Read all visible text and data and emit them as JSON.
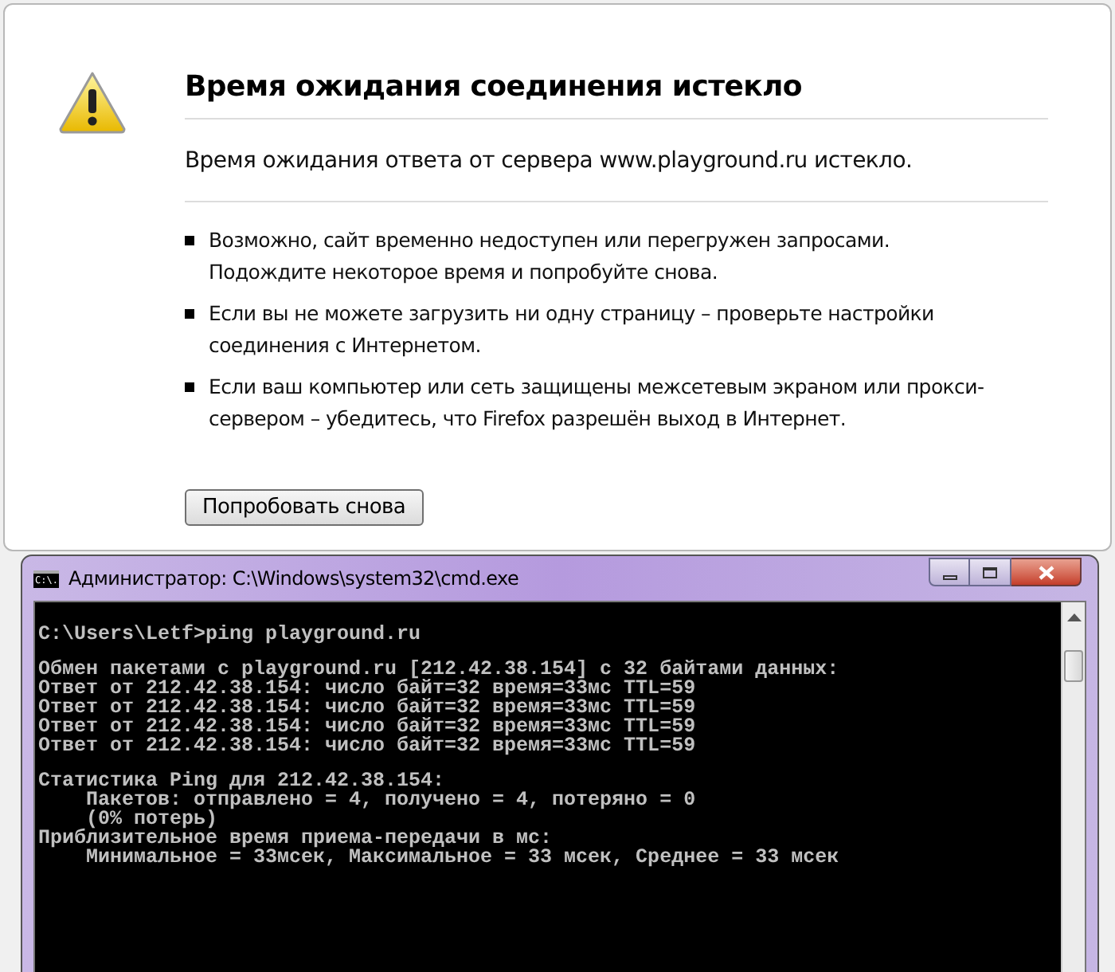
{
  "error_page": {
    "title": "Время ожидания соединения истекло",
    "subtitle": "Время ожидания ответа от сервера www.playground.ru истекло.",
    "bullets": [
      "Возможно, сайт временно недоступен или перегружен запросами. Подождите некоторое время и попробуйте снова.",
      "Если вы не можете загрузить ни одну страницу – проверьте настройки соединения с Интернетом.",
      "Если ваш компьютер или сеть защищены межсетевым экраном или прокси-сервером – убедитесь, что Firefox разрешён выход в Интернет."
    ],
    "retry_button": "Попробовать снова"
  },
  "console_window": {
    "title": "Администратор: C:\\Windows\\system32\\cmd.exe",
    "icon_label": "C:\\.",
    "blocks": [
      [
        "C:\\Users\\Letf>ping playground.ru"
      ],
      [
        "Обмен пакетами с playground.ru [212.42.38.154] с 32 байтами данных:",
        "Ответ от 212.42.38.154: число байт=32 время=33мс TTL=59",
        "Ответ от 212.42.38.154: число байт=32 время=33мс TTL=59",
        "Ответ от 212.42.38.154: число байт=32 время=33мс TTL=59",
        "Ответ от 212.42.38.154: число байт=32 время=33мс TTL=59"
      ],
      [
        "Статистика Ping для 212.42.38.154:",
        "    Пакетов: отправлено = 4, получено = 4, потеряно = 0",
        "    (0% потерь)",
        "Приблизительное время приема-передачи в мс:",
        "    Минимальное = 33мсек, Максимальное = 33 мсек, Среднее = 33 мсек"
      ]
    ]
  }
}
